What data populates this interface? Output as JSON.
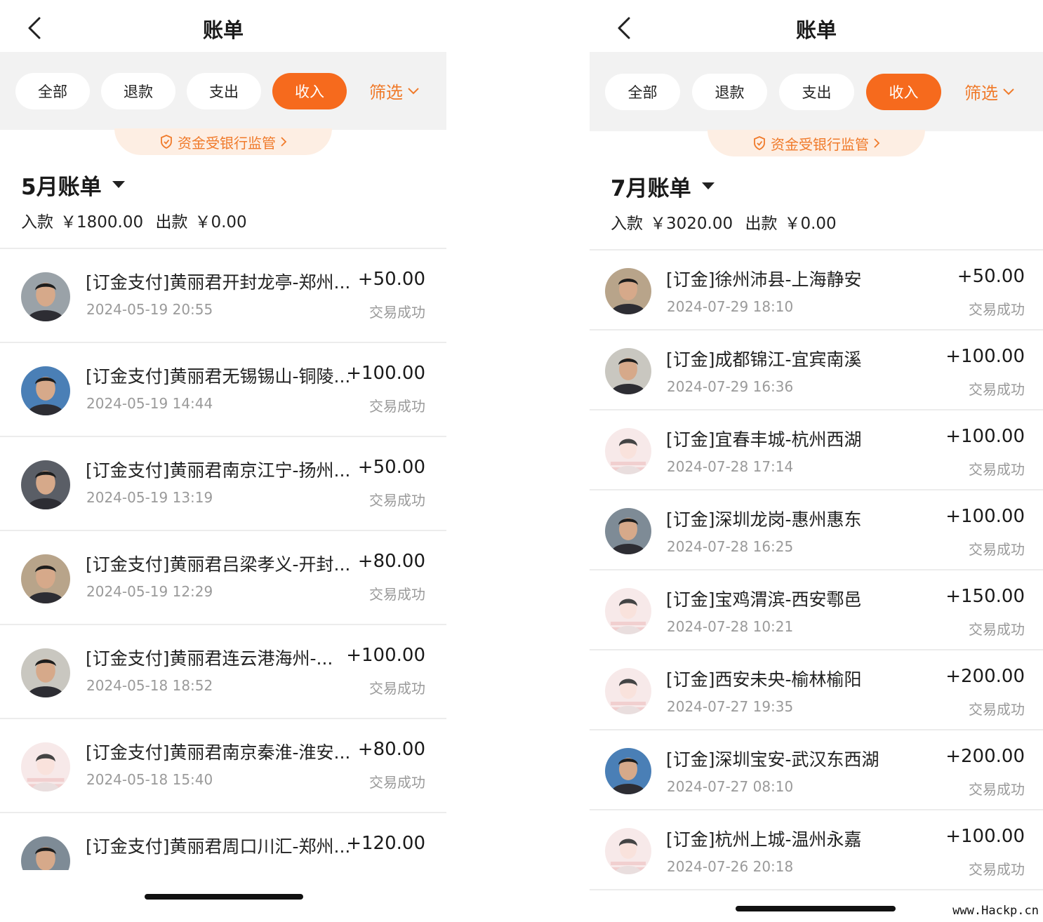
{
  "left": {
    "title": "账单",
    "tabs": [
      "全部",
      "退款",
      "支出",
      "收入"
    ],
    "active_tab": "收入",
    "filter_label": "筛选",
    "bank_notice": "资金受银行监管",
    "month_title": "5月账单",
    "summary_in_label": "入款",
    "summary_in": "￥1800.00",
    "summary_out_label": "出款",
    "summary_out": "￥0.00",
    "rows": [
      {
        "title": "[订金支付]黄丽君开封龙亭-郑州...",
        "time": "2024-05-19 20:55",
        "amount": "+50.00",
        "status": "交易成功",
        "avatar": "photo-avatar"
      },
      {
        "title": "[订金支付]黄丽君无锡锡山-铜陵...",
        "time": "2024-05-19 14:44",
        "amount": "+100.00",
        "status": "交易成功",
        "avatar": "photo-avatar"
      },
      {
        "title": "[订金支付]黄丽君南京江宁-扬州...",
        "time": "2024-05-19 13:19",
        "amount": "+50.00",
        "status": "交易成功",
        "avatar": "photo-avatar"
      },
      {
        "title": "[订金支付]黄丽君吕梁孝义-开封...",
        "time": "2024-05-19 12:29",
        "amount": "+80.00",
        "status": "交易成功",
        "avatar": "photo-avatar"
      },
      {
        "title": "[订金支付]黄丽君连云港海州-...",
        "time": "2024-05-18 18:52",
        "amount": "+100.00",
        "status": "交易成功",
        "avatar": "photo-avatar"
      },
      {
        "title": "[订金支付]黄丽君南京秦淮-淮安...",
        "time": "2024-05-18 15:40",
        "amount": "+80.00",
        "status": "交易成功",
        "avatar": "default-avatar"
      },
      {
        "title": "[订金支付]黄丽君周口川汇-郑州...",
        "time": "",
        "amount": "+120.00",
        "status": "",
        "avatar": "photo-avatar"
      }
    ]
  },
  "right": {
    "title": "账单",
    "tabs": [
      "全部",
      "退款",
      "支出",
      "收入"
    ],
    "active_tab": "收入",
    "filter_label": "筛选",
    "bank_notice": "资金受银行监管",
    "month_title": "7月账单",
    "summary_in_label": "入款",
    "summary_in": "￥3020.00",
    "summary_out_label": "出款",
    "summary_out": "￥0.00",
    "rows": [
      {
        "title": "[订金]徐州沛县-上海静安",
        "time": "2024-07-29 18:10",
        "amount": "+50.00",
        "status": "交易成功",
        "avatar": "photo-avatar"
      },
      {
        "title": "[订金]成都锦江-宜宾南溪",
        "time": "2024-07-29 16:36",
        "amount": "+100.00",
        "status": "交易成功",
        "avatar": "photo-avatar"
      },
      {
        "title": "[订金]宜春丰城-杭州西湖",
        "time": "2024-07-28 17:14",
        "amount": "+100.00",
        "status": "交易成功",
        "avatar": "default-avatar"
      },
      {
        "title": "[订金]深圳龙岗-惠州惠东",
        "time": "2024-07-28 16:25",
        "amount": "+100.00",
        "status": "交易成功",
        "avatar": "photo-avatar"
      },
      {
        "title": "[订金]宝鸡渭滨-西安鄠邑",
        "time": "2024-07-28 10:21",
        "amount": "+150.00",
        "status": "交易成功",
        "avatar": "default-avatar"
      },
      {
        "title": "[订金]西安未央-榆林榆阳",
        "time": "2024-07-27 19:35",
        "amount": "+200.00",
        "status": "交易成功",
        "avatar": "default-avatar"
      },
      {
        "title": "[订金]深圳宝安-武汉东西湖",
        "time": "2024-07-27 08:10",
        "amount": "+200.00",
        "status": "交易成功",
        "avatar": "photo-avatar"
      },
      {
        "title": "[订金]杭州上城-温州永嘉",
        "time": "2024-07-26 20:18",
        "amount": "+100.00",
        "status": "交易成功",
        "avatar": "default-avatar"
      }
    ]
  },
  "watermark": "www.Hackp.cn",
  "colors": {
    "accent": "#f66a1d",
    "accent_text": "#f07a2a",
    "badge_bg": "#fdeee3",
    "bar_bg": "#f2f2f2"
  }
}
